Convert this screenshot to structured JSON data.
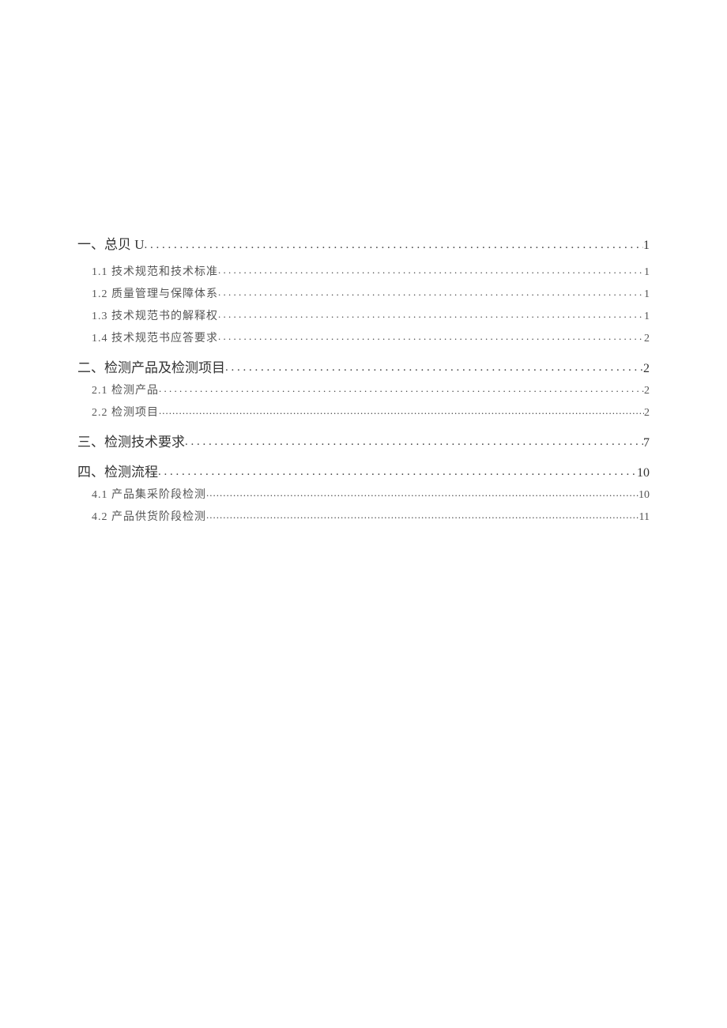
{
  "toc": {
    "entries": [
      {
        "level": 1,
        "label": "一、总贝 U",
        "page": "1",
        "style": "first"
      },
      {
        "level": 2,
        "label": "1.1  技术规范和技术标准",
        "page": "1",
        "style": "std"
      },
      {
        "level": 2,
        "label": "1.2  质量管理与保障体系 ",
        "page": "1",
        "style": "std"
      },
      {
        "level": 2,
        "label": "1.3  技术规范书的解释权 ",
        "page": "1",
        "style": "std"
      },
      {
        "level": 2,
        "label": "1.4  技术规范书应答要求 ",
        "page": "2",
        "style": "std"
      },
      {
        "level": 1,
        "label": "二、检测产品及检测项目 ",
        "page": "2",
        "style": "h1"
      },
      {
        "level": 2,
        "label": "2.1   检测产品 ",
        "page": "2",
        "style": "std"
      },
      {
        "level": 2,
        "label": "2.2   检测项目",
        "page": "2",
        "style": "tight"
      },
      {
        "level": 1,
        "label": "三、检测技术要求 ",
        "page": "7",
        "style": "h1"
      },
      {
        "level": 1,
        "label": "四、检测流程 ",
        "page": "10",
        "style": "h1"
      },
      {
        "level": 2,
        "label": "4.1 产品集采阶段检测",
        "page": "10",
        "style": "tight"
      },
      {
        "level": 2,
        "label": "4.2 产品供货阶段检测",
        "page": "11",
        "style": "tight"
      }
    ]
  }
}
